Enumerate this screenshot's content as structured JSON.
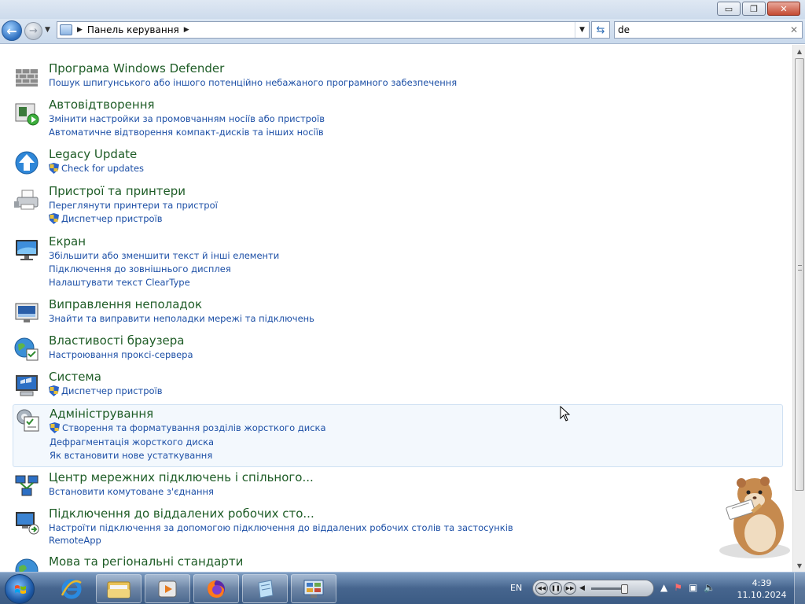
{
  "window": {
    "caption_buttons": {
      "minimize": "▭",
      "maximize": "❐",
      "close": "✕"
    }
  },
  "navbar": {
    "address_path": "Панель керування",
    "search_value": "de",
    "history_glyph": "▼",
    "dropdown_glyph": "▼"
  },
  "results": [
    {
      "title": "Програма Windows Defender",
      "icon": "brick-wall-icon",
      "links": [
        {
          "text": "Пошук шпигунського або іншого потенційно небажаного програмного забезпечення",
          "shield": false
        }
      ]
    },
    {
      "title": "Автовідтворення",
      "icon": "autoplay-icon",
      "links": [
        {
          "text": "Змінити настройки за промовчанням носіїв або пристроїв",
          "shield": false
        },
        {
          "text": "Автоматичне відтворення компакт-дисків та інших носіїв",
          "shield": false
        }
      ]
    },
    {
      "title": "Legacy Update",
      "icon": "update-arrow-icon",
      "links": [
        {
          "text": "Check for updates",
          "shield": true
        }
      ]
    },
    {
      "title": "Пристрої та принтери",
      "icon": "printer-icon",
      "links": [
        {
          "text": "Переглянути принтери та пристрої",
          "shield": false
        },
        {
          "text": "Диспетчер пристроїв",
          "shield": true
        }
      ]
    },
    {
      "title": "Екран",
      "icon": "monitor-icon",
      "links": [
        {
          "text": "Збільшити або зменшити текст й інші елементи",
          "shield": false
        },
        {
          "text": "Підключення до зовнішнього дисплея",
          "shield": false
        },
        {
          "text": "Налаштувати текст ClearType",
          "shield": false
        }
      ]
    },
    {
      "title": "Виправлення неполадок",
      "icon": "troubleshoot-icon",
      "links": [
        {
          "text": "Знайти та виправити неполадки мережі та підключень",
          "shield": false
        }
      ]
    },
    {
      "title": "Властивості браузера",
      "icon": "internet-options-icon",
      "links": [
        {
          "text": "Настроювання проксі-сервера",
          "shield": false
        }
      ]
    },
    {
      "title": "Система",
      "icon": "system-icon",
      "links": [
        {
          "text": "Диспетчер пристроїв",
          "shield": true
        }
      ]
    },
    {
      "title": "Адміністрування",
      "icon": "admin-tools-icon",
      "links": [
        {
          "text": "Створення та форматування розділів жорсткого диска",
          "shield": true
        },
        {
          "text": "Дефрагментація жорсткого диска",
          "shield": false
        },
        {
          "text": "Як встановити нове устаткування",
          "shield": false
        }
      ]
    },
    {
      "title": "Центр мережних підключень і спільного...",
      "icon": "network-center-icon",
      "links": [
        {
          "text": "Встановити комутоване з'єднання",
          "shield": false
        }
      ]
    },
    {
      "title": "Підключення до віддалених робочих сто...",
      "icon": "remote-desktop-icon",
      "links": [
        {
          "text": "Настроїти підключення за допомогою підключення до віддалених робочих столів та застосунків",
          "shield": false
        },
        {
          "text": "RemoteApp",
          "shield": false
        }
      ]
    },
    {
      "title": "Мова та регіональні стандарти",
      "icon": "region-globe-icon",
      "links": []
    }
  ],
  "taskbar": {
    "language": "EN",
    "clock_time": "4:39",
    "clock_date": "11.10.2024",
    "pinned": [
      "internet-explorer-icon",
      "explorer-folder-icon",
      "media-player-icon",
      "firefox-icon",
      "notepad-icon",
      "control-panel-icon"
    ]
  },
  "colors": {
    "title": "#1e5c26",
    "link": "#1c4fa6",
    "taskbar": "#46658e"
  }
}
